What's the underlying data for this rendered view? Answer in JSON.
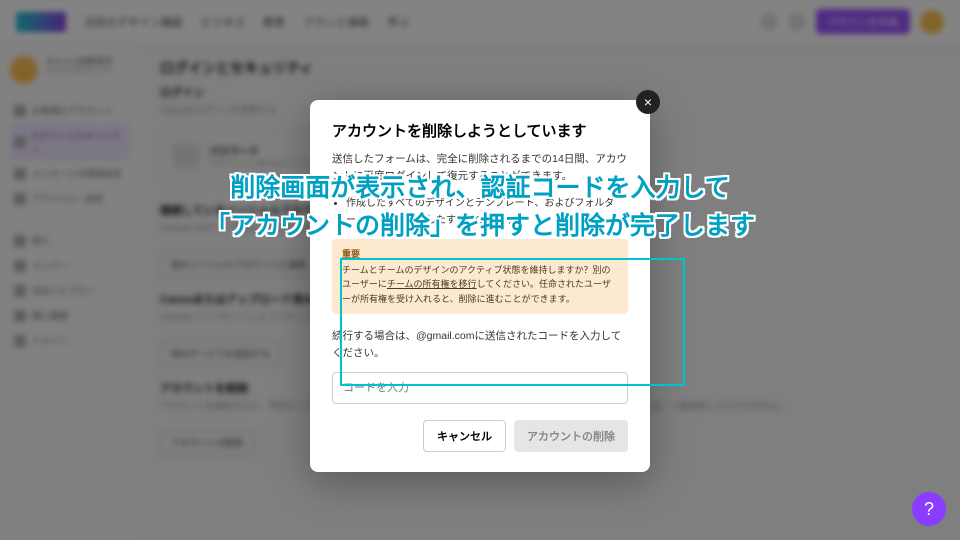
{
  "topnav": {
    "items": [
      "注目のデザイン機能",
      "ビジネス",
      "教育",
      "プランと価格",
      "学ぶ"
    ]
  },
  "cta": {
    "label": "デザインを作成"
  },
  "sidebar": {
    "user": {
      "name": "キャンバ太郎/花子",
      "sub": "example@gmail.com"
    },
    "items": [
      "お客様のアカウント",
      "ログインとセキュリティ",
      "メッセージの環境設定",
      "プライバシー設定"
    ],
    "team_header": "個人",
    "team_items": [
      "メンバー",
      "支払いとプラン",
      "購入履歴",
      "ドメイン"
    ]
  },
  "content": {
    "title": "ログインとセキュリティ",
    "sub": "ログイン",
    "desc": "Canvaのログインを変更する",
    "card": {
      "title": "パスワード",
      "desc": "アカウントに強力なパスワードを設定して、不正なログインから保護します。"
    },
    "sec2_title": "接続しているソーシャルアカウント",
    "sec2_desc": "Canvaにログイン可能なサービスです",
    "btn2": "他のソーシャルアカウントに接続",
    "sec3_title": "Canvaまたはアップロード済みのデザインの保存",
    "sec3_desc": "Canvaにアップロードしたコンテンツの設定を行うことができます",
    "btn3": "他のサービスを追加する",
    "sec4_title": "アカウントを削除",
    "sec4_desc": "アカウントを削除すると、予告なくコンテンツやファイルにアクセスできなくなります。Canvaアカウントを回復することは、一度削除したらできません。",
    "btn4": "アカウントの削除"
  },
  "dialog": {
    "title": "アカウントを削除しようとしています",
    "p1": "送信したフォームは、完全に削除されるまでの14日間、アカウントに再度ログインして復元することができます。",
    "list": "作成したすべてのデザインとテンプレート、およびフォルダー・アップロードしたすべてのメディア",
    "warn_title": "重要",
    "warn_body": "チームとチームのデザインのアクティブ状態を維持しますか？別のユーザーに",
    "warn_link": "チームの所有権を移行",
    "warn_body2": "してください。任命されたユーザーが所有権を受け入れると、削除に進むことができます。",
    "p2a": "続行する場合は、",
    "p2b": "@gmail.comに送信されたコードを入力してください。",
    "placeholder": "コードを入力",
    "cancel": "キャンセル",
    "delete": "アカウントの削除"
  },
  "banner": {
    "line1": "削除画面が表示され、認証コードを入力して",
    "line2": "「アカウントの削除」を押すと削除が完了します"
  }
}
